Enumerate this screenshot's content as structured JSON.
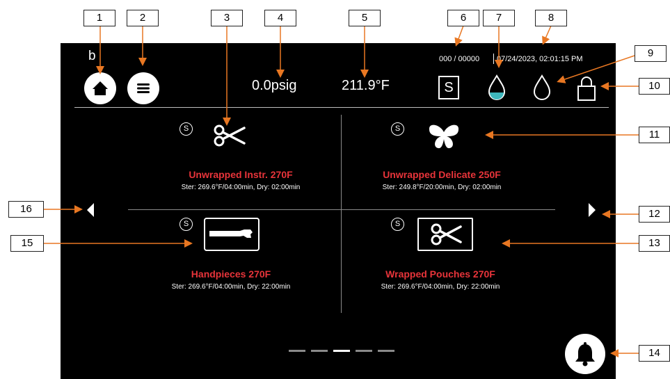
{
  "header": {
    "corner_char": "b",
    "pressure": "0.0psig",
    "temperature": "211.9°F",
    "cycle_counter": "000 / 00000",
    "datetime": "07/24/2023, 02:01:15 PM",
    "mode_letter": "S"
  },
  "icons": {
    "home": "home-icon",
    "menu": "menu-icon",
    "mode": "s-mode-icon",
    "water_level": "water-drop-filled-icon",
    "water_quality": "water-drop-outline-icon",
    "lock": "lock-icon",
    "bell": "bell-icon"
  },
  "programs": [
    {
      "name": "Unwrapped Instr. 270F",
      "params": "Ster: 269.6°F/04:00min, Dry: 02:00min",
      "badge": "S",
      "icon": "scissors-icon"
    },
    {
      "name": "Unwrapped Delicate 250F",
      "params": "Ster: 249.8°F/20:00min, Dry: 02:00min",
      "badge": "S",
      "icon": "butterfly-icon"
    },
    {
      "name": "Handpieces 270F",
      "params": "Ster: 269.6°F/04:00min, Dry: 22:00min",
      "badge": "S",
      "icon": "handpiece-icon"
    },
    {
      "name": "Wrapped Pouches 270F",
      "params": "Ster: 269.6°F/04:00min, Dry: 22:00min",
      "badge": "S",
      "icon": "wrapped-scissors-icon"
    }
  ],
  "pagination": {
    "total_pages": 5,
    "current_page": 3
  },
  "callouts": [
    "1",
    "2",
    "3",
    "4",
    "5",
    "6",
    "7",
    "8",
    "9",
    "10",
    "11",
    "12",
    "13",
    "14",
    "15",
    "16"
  ],
  "colors": {
    "screen_bg": "#000000",
    "program_name": "#e8343a",
    "callout_arrow": "#e87722",
    "water_fill": "#3fb8bd"
  }
}
